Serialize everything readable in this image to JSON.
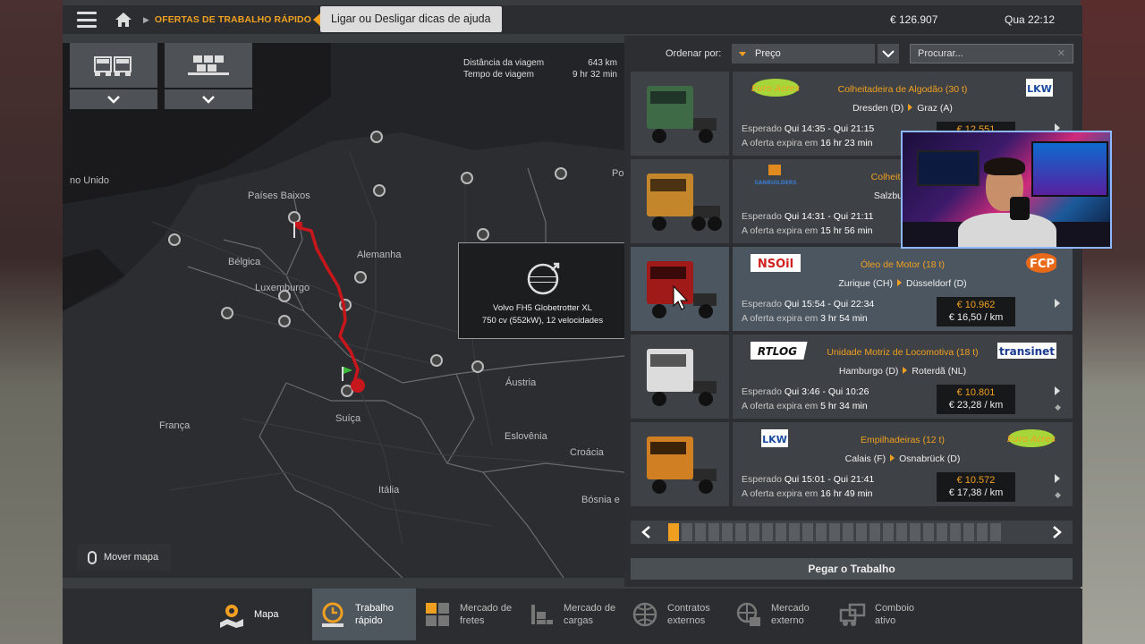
{
  "topbar": {
    "breadcrumb": "OFERTAS DE TRABALHO RÁPIDO",
    "help_label": "?",
    "tooltip": "Ligar ou Desligar dicas de ajuda",
    "money": "€ 126.907",
    "clock": "Qua 22:12"
  },
  "map": {
    "trip": {
      "distance_label": "Distância da viagem",
      "distance_value": "643 km",
      "time_label": "Tempo de viagem",
      "time_value": "9 hr 32 min"
    },
    "labels": {
      "uk": "no Unido",
      "netherlands": "Países Baixos",
      "belgium": "Bélgica",
      "germany": "Alemanha",
      "luxembourg": "Luxemburgo",
      "france": "França",
      "switzerland": "Suíça",
      "austria": "Áustria",
      "slovenia": "Eslovênia",
      "croatia": "Croácia",
      "italy": "Itália",
      "poland": "Po",
      "bosnia": "Bósnia e"
    },
    "truck": {
      "name": "Volvo FH5 Globetrotter XL",
      "spec": "750 cv (552kW), 12 velocidades"
    },
    "move_map": "Mover mapa",
    "buttons": [
      "truck-icon",
      "trailer-icon"
    ]
  },
  "sort": {
    "label": "Ordenar por:",
    "value": "Preço",
    "search_placeholder": "Procurar..."
  },
  "jobs": [
    {
      "cargo": "Colheitadeira de Algodão (30 t)",
      "from": "Dresden (D)",
      "to": "Graz (A)",
      "expected_label": "Esperado",
      "expected": "Qui 14:35 - Qui 21:15",
      "expire_label": "A oferta expira em",
      "expire": "16 hr 23 min",
      "total": "€ 12.551",
      "rate": "",
      "logo_left": "EuroAcres",
      "logo_right": "LKW",
      "truck_color": "#3f6a46"
    },
    {
      "cargo": "Colheitadeira d",
      "from": "Salzburgo (A)",
      "to": "",
      "expected_label": "Esperado",
      "expected": "Qui 14:31 - Qui 21:11",
      "expire_label": "A oferta expira em",
      "expire": "15 hr 56 min",
      "total": "",
      "rate": "",
      "logo_left": "SANBUILDERS",
      "logo_right": "",
      "truck_color": "#c4862a"
    },
    {
      "cargo": "Óleo de Motor (18 t)",
      "from": "Zurique (CH)",
      "to": "Düsseldorf (D)",
      "expected_label": "Esperado",
      "expected": "Qui 15:54 - Qui 22:34",
      "expire_label": "A oferta expira em",
      "expire": "3 hr 54 min",
      "total": "€ 10.962",
      "rate": "€ 16,50 / km",
      "logo_left": "NSOil",
      "logo_right": "FCP",
      "truck_color": "#a11a1a"
    },
    {
      "cargo": "Unidade Motriz de Locomotiva (18 t)",
      "from": "Hamburgo (D)",
      "to": "Roterdã (NL)",
      "expected_label": "Esperado",
      "expected": "Qui 3:46 - Qui 10:26",
      "expire_label": "A oferta expira em",
      "expire": "5 hr 34 min",
      "total": "€ 10.801",
      "rate": "€ 23,28 / km",
      "logo_left": "RTLOG",
      "logo_right": "transinet",
      "truck_color": "#dcdcdc"
    },
    {
      "cargo": "Empilhadeiras (12 t)",
      "from": "Calais (F)",
      "to": "Osnabrück (D)",
      "expected_label": "Esperado",
      "expected": "Qui 15:01 - Qui 21:41",
      "expire_label": "A oferta expira em",
      "expire": "16 hr 49 min",
      "total": "€ 10.572",
      "rate": "€ 17,38 / km",
      "logo_left": "LKW",
      "logo_right": "EuroAcres",
      "truck_color": "#d07f22"
    }
  ],
  "pager": {
    "current": 1,
    "total": 25
  },
  "take_job": "Pegar o Trabalho",
  "nav": [
    {
      "label": "Mapa",
      "icon": "map-icon"
    },
    {
      "label": "Trabalho rápido",
      "icon": "clock-icon"
    },
    {
      "label": "Mercado de fretes",
      "icon": "crates-icon"
    },
    {
      "label": "Mercado de cargas",
      "icon": "cargo-icon"
    },
    {
      "label": "Contratos externos",
      "icon": "globe-icon"
    },
    {
      "label": "Mercado externo",
      "icon": "globe-cargo-icon"
    },
    {
      "label": "Comboio ativo",
      "icon": "convoy-icon"
    }
  ],
  "nav_lines": {
    "n1a": "Trabalho",
    "n1b": "rápido",
    "n2a": "Mercado de",
    "n2b": "fretes",
    "n3a": "Mercado de",
    "n3b": "cargas",
    "n4a": "Contratos",
    "n4b": "externos",
    "n5a": "Mercado",
    "n5b": "externo",
    "n6a": "Comboio",
    "n6b": "ativo"
  },
  "logos": {
    "l1": "Euro Acres",
    "r1": "LKW",
    "l2": "SANBUILDERS",
    "l3": "NSOil",
    "r3": "FCP",
    "l4": "RTLOG",
    "r4": "transinet",
    "l5": "LKW",
    "r5": "Euro Acres"
  },
  "colors": {
    "accent": "#f0a020",
    "route": "#c8161d",
    "panel": "#3e4145"
  }
}
